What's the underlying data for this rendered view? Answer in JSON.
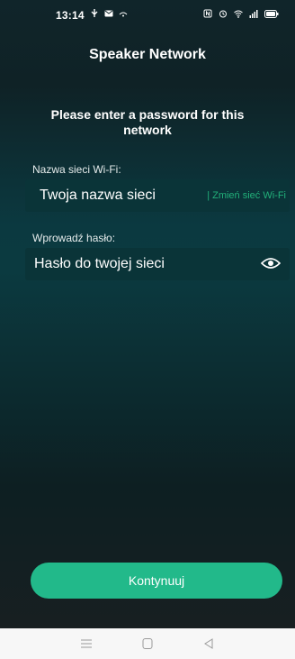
{
  "status_bar": {
    "time": "13:14"
  },
  "title": "Speaker Network",
  "prompt": "Please enter a password for this network",
  "wifi": {
    "label": "Nazwa sieci Wi-Fi:",
    "value": "Twoja nazwa sieci",
    "change_link": "| Zmień sieć Wi-Fi"
  },
  "password": {
    "label": "Wprowadź hasło:",
    "value": "Hasło do twojej sieci"
  },
  "continue_label": "Kontynuuj",
  "colors": {
    "accent": "#22b98a",
    "link": "#22b07a",
    "background": "#0b3a40"
  },
  "icons": {
    "status_left": [
      "usb-icon",
      "mail-icon",
      "wifi-scan-icon"
    ],
    "status_right": [
      "nfc-icon",
      "alarm-icon",
      "wifi-icon",
      "signal-icon",
      "battery-icon"
    ],
    "password_toggle": "eye-icon",
    "nav": [
      "menu-icon",
      "home-icon",
      "back-icon"
    ]
  }
}
